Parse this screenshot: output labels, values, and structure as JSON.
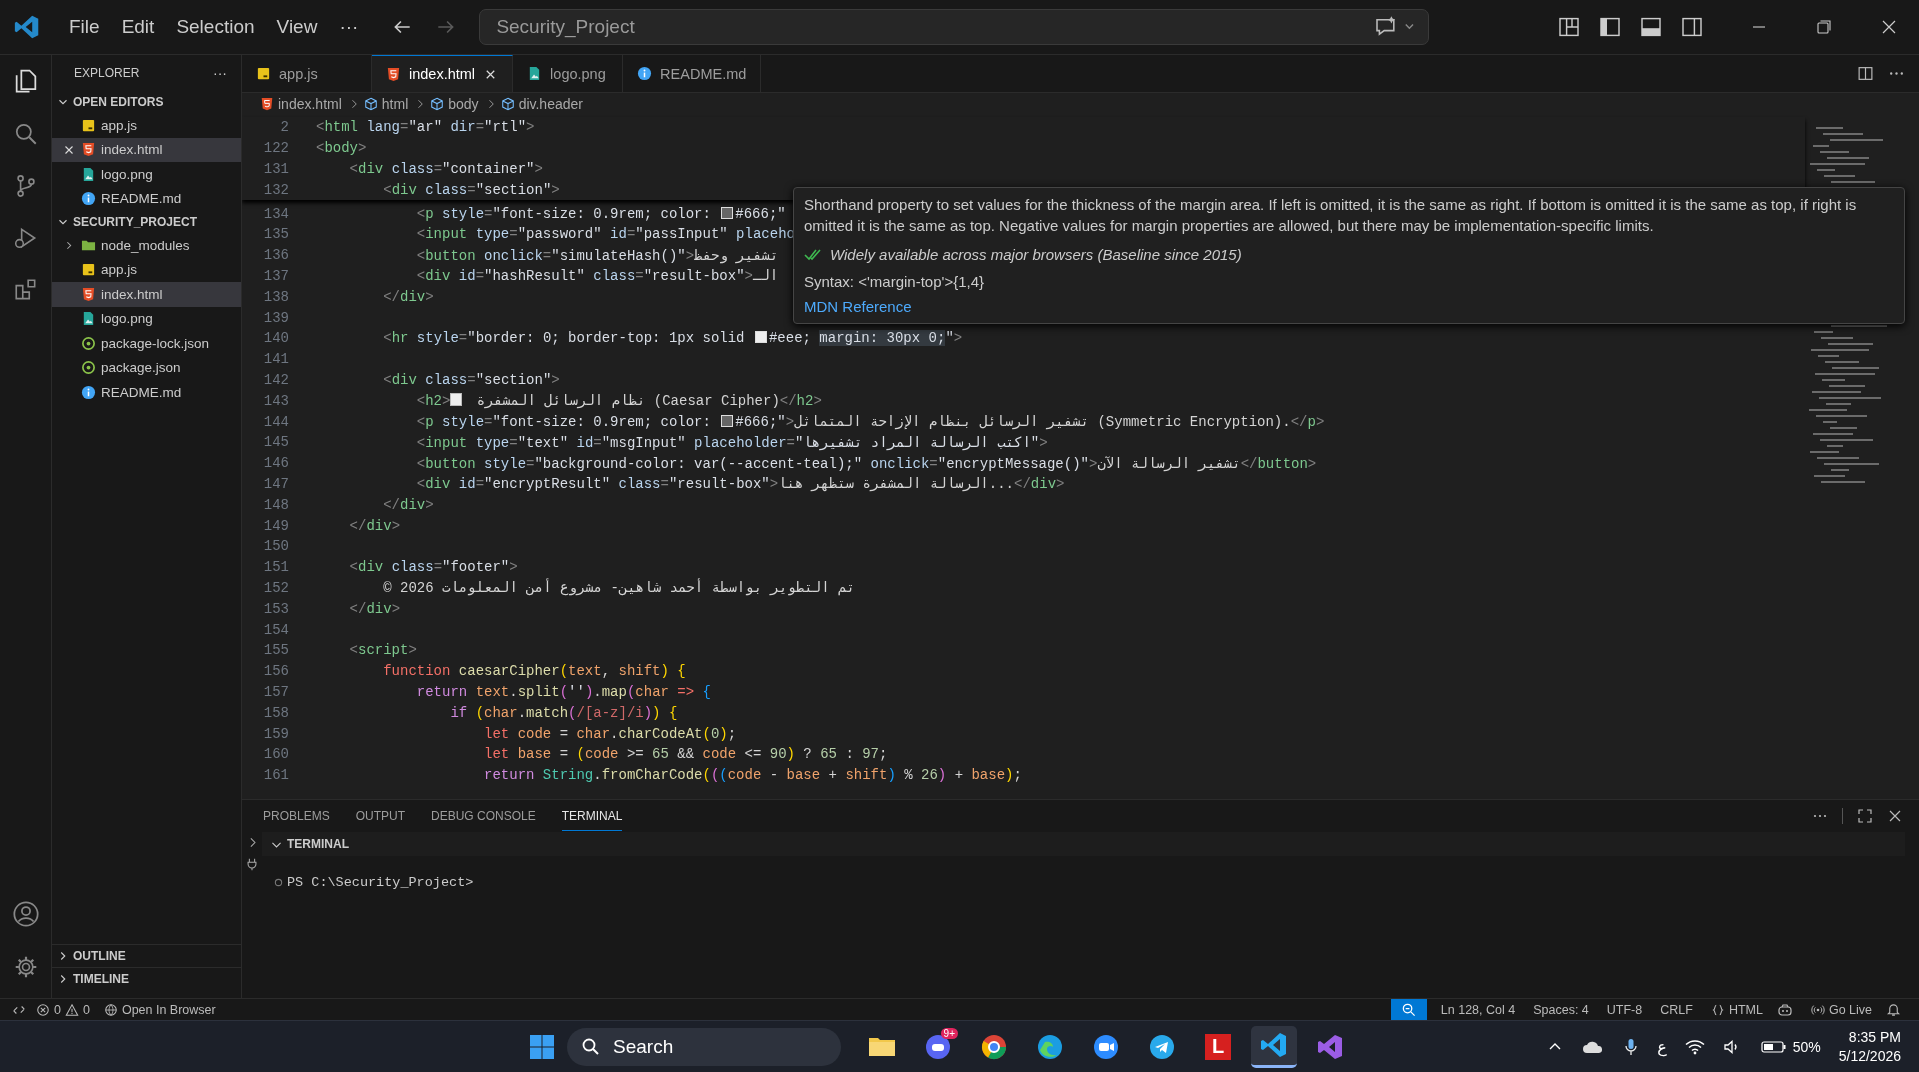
{
  "title_bar": {
    "menus": [
      "File",
      "Edit",
      "Selection",
      "View"
    ],
    "more": "···",
    "command_center": "Security_Project",
    "forward_disabled": true
  },
  "sidebar": {
    "title": "EXPLORER",
    "more": "···",
    "sections": [
      {
        "label": "OPEN EDITORS",
        "expanded": true,
        "items": [
          {
            "name": "app.js",
            "kind": "js",
            "selected": false
          },
          {
            "name": "index.html",
            "kind": "html",
            "selected": true
          },
          {
            "name": "logo.png",
            "kind": "png",
            "selected": false
          },
          {
            "name": "README.md",
            "kind": "md",
            "selected": false
          }
        ]
      },
      {
        "label": "SECURITY_PROJECT",
        "expanded": true,
        "items": [
          {
            "name": "node_modules",
            "kind": "folder",
            "selected": false,
            "expanded": false
          },
          {
            "name": "app.js",
            "kind": "js",
            "selected": false
          },
          {
            "name": "index.html",
            "kind": "html",
            "selected": true
          },
          {
            "name": "logo.png",
            "kind": "png",
            "selected": false
          },
          {
            "name": "package-lock.json",
            "kind": "json",
            "selected": false
          },
          {
            "name": "package.json",
            "kind": "json",
            "selected": false
          },
          {
            "name": "README.md",
            "kind": "md",
            "selected": false
          }
        ]
      }
    ],
    "bottom_sections": [
      {
        "label": "OUTLINE",
        "expanded": false
      },
      {
        "label": "TIMELINE",
        "expanded": false
      }
    ]
  },
  "tabs": [
    {
      "label": "app.js",
      "kind": "js",
      "selected": false
    },
    {
      "label": "index.html",
      "kind": "html",
      "selected": true
    },
    {
      "label": "logo.png",
      "kind": "png",
      "selected": false
    },
    {
      "label": "README.md",
      "kind": "md",
      "selected": false
    }
  ],
  "breadcrumb": [
    {
      "label": "index.html",
      "kind": "html"
    },
    {
      "label": "html",
      "kind": "symbol"
    },
    {
      "label": "body",
      "kind": "symbol"
    },
    {
      "label": "div.header",
      "kind": "symbol"
    }
  ],
  "editor": {
    "sticky_lines": [
      {
        "number": "2",
        "tokens": [
          {
            "kind": "pu",
            "text": "<"
          },
          {
            "kind": "tg",
            "text": "html"
          },
          {
            "kind": "at",
            "text": " lang"
          },
          {
            "kind": "pu",
            "text": "="
          },
          {
            "kind": "st",
            "text": "\"ar\""
          },
          {
            "kind": "at",
            "text": " dir"
          },
          {
            "kind": "pu",
            "text": "="
          },
          {
            "kind": "st",
            "text": "\"rtl\""
          },
          {
            "kind": "pu",
            "text": ">"
          }
        ]
      },
      {
        "number": "122",
        "tokens": [
          {
            "kind": "pu",
            "text": "<"
          },
          {
            "kind": "tg",
            "text": "body"
          },
          {
            "kind": "pu",
            "text": ">"
          }
        ]
      },
      {
        "number": "131",
        "tokens": [
          {
            "kind": "pu",
            "text": "    <"
          },
          {
            "kind": "tg",
            "text": "div"
          },
          {
            "kind": "at",
            "text": " class"
          },
          {
            "kind": "pu",
            "text": "="
          },
          {
            "kind": "st",
            "text": "\"container\""
          },
          {
            "kind": "pu",
            "text": ">"
          }
        ]
      },
      {
        "number": "132",
        "tokens": [
          {
            "kind": "pu",
            "text": "        <"
          },
          {
            "kind": "tg",
            "text": "div"
          },
          {
            "kind": "at",
            "text": " class"
          },
          {
            "kind": "pu",
            "text": "="
          },
          {
            "kind": "st",
            "text": "\"section\""
          },
          {
            "kind": "pu",
            "text": ">"
          }
        ]
      }
    ],
    "lines": [
      {
        "number": "134",
        "tokens": [
          {
            "kind": "pu",
            "text": "            <"
          },
          {
            "kind": "tg",
            "text": "p"
          },
          {
            "kind": "at",
            "text": " style"
          },
          {
            "kind": "pu",
            "text": "="
          },
          {
            "kind": "st",
            "text": "\"font-size: 0.9rem; color: "
          },
          {
            "kind": "swatch",
            "color": "#666666"
          },
          {
            "kind": "st",
            "text": "#666;\""
          }
        ]
      },
      {
        "number": "135",
        "tokens": [
          {
            "kind": "pu",
            "text": "            <"
          },
          {
            "kind": "tg",
            "text": "input"
          },
          {
            "kind": "at",
            "text": " type"
          },
          {
            "kind": "pu",
            "text": "="
          },
          {
            "kind": "st",
            "text": "\"password\""
          },
          {
            "kind": "at",
            "text": " id"
          },
          {
            "kind": "pu",
            "text": "="
          },
          {
            "kind": "st",
            "text": "\"passInput\""
          },
          {
            "kind": "at",
            "text": " placeho"
          }
        ]
      },
      {
        "number": "136",
        "tokens": [
          {
            "kind": "pu",
            "text": "            <"
          },
          {
            "kind": "tg",
            "text": "button"
          },
          {
            "kind": "at",
            "text": " onclick"
          },
          {
            "kind": "pu",
            "text": "="
          },
          {
            "kind": "st",
            "text": "\"simulateHash()\""
          },
          {
            "kind": "pu",
            "text": ">"
          },
          {
            "kind": "tx",
            "text": "تشفير وحفظ"
          }
        ]
      },
      {
        "number": "137",
        "tokens": [
          {
            "kind": "pu",
            "text": "            <"
          },
          {
            "kind": "tg",
            "text": "div"
          },
          {
            "kind": "at",
            "text": " id"
          },
          {
            "kind": "pu",
            "text": "="
          },
          {
            "kind": "st",
            "text": "\"hashResult\""
          },
          {
            "kind": "at",
            "text": " class"
          },
          {
            "kind": "pu",
            "text": "="
          },
          {
            "kind": "st",
            "text": "\"result-box\""
          },
          {
            "kind": "pu",
            "text": ">"
          },
          {
            "kind": "tx",
            "text": "الـ"
          }
        ]
      },
      {
        "number": "138",
        "tokens": [
          {
            "kind": "pu",
            "text": "        </"
          },
          {
            "kind": "tg",
            "text": "div"
          },
          {
            "kind": "pu",
            "text": ">"
          }
        ]
      },
      {
        "number": "139"
      },
      {
        "number": "140",
        "tokens": [
          {
            "kind": "pu",
            "text": "        <"
          },
          {
            "kind": "tg",
            "text": "hr"
          },
          {
            "kind": "at",
            "text": " style"
          },
          {
            "kind": "pu",
            "text": "="
          },
          {
            "kind": "st",
            "text": "\"border: 0; border-top: 1px solid "
          },
          {
            "kind": "swatch",
            "color": "#eeeeee"
          },
          {
            "kind": "st",
            "text": "#eee; "
          },
          {
            "kind": "hl",
            "text": "margin: 30px 0;"
          },
          {
            "kind": "st",
            "text": "\""
          },
          {
            "kind": "pu",
            "text": ">"
          }
        ]
      },
      {
        "number": "141"
      },
      {
        "number": "142",
        "tokens": [
          {
            "kind": "pu",
            "text": "        <"
          },
          {
            "kind": "tg",
            "text": "div"
          },
          {
            "kind": "at",
            "text": " class"
          },
          {
            "kind": "pu",
            "text": "="
          },
          {
            "kind": "st",
            "text": "\"section\""
          },
          {
            "kind": "pu",
            "text": ">"
          }
        ]
      },
      {
        "number": "143",
        "tokens": [
          {
            "kind": "pu",
            "text": "            <"
          },
          {
            "kind": "tg",
            "text": "h2"
          },
          {
            "kind": "pu",
            "text": ">"
          },
          {
            "kind": "tofu"
          },
          {
            "kind": "tx",
            "text": " نظام الرسائل المشفرة (Caesar Cipher)"
          },
          {
            "kind": "pu",
            "text": "</"
          },
          {
            "kind": "tg",
            "text": "h2"
          },
          {
            "kind": "pu",
            "text": ">"
          }
        ]
      },
      {
        "number": "144",
        "tokens": [
          {
            "kind": "pu",
            "text": "            <"
          },
          {
            "kind": "tg",
            "text": "p"
          },
          {
            "kind": "at",
            "text": " style"
          },
          {
            "kind": "pu",
            "text": "="
          },
          {
            "kind": "st",
            "text": "\"font-size: 0.9rem; color: "
          },
          {
            "kind": "swatch",
            "color": "#666666"
          },
          {
            "kind": "st",
            "text": "#666;\""
          },
          {
            "kind": "pu",
            "text": ">"
          },
          {
            "kind": "tx",
            "text": "تشفير الرسائل بنظام الإزاحة المتماثل (Symmetric Encryption)."
          },
          {
            "kind": "pu",
            "text": "</"
          },
          {
            "kind": "tg",
            "text": "p"
          },
          {
            "kind": "pu",
            "text": ">"
          }
        ]
      },
      {
        "number": "145",
        "tokens": [
          {
            "kind": "pu",
            "text": "            <"
          },
          {
            "kind": "tg",
            "text": "input"
          },
          {
            "kind": "at",
            "text": " type"
          },
          {
            "kind": "pu",
            "text": "="
          },
          {
            "kind": "st",
            "text": "\"text\""
          },
          {
            "kind": "at",
            "text": " id"
          },
          {
            "kind": "pu",
            "text": "="
          },
          {
            "kind": "st",
            "text": "\"msgInput\""
          },
          {
            "kind": "at",
            "text": " placeholder"
          },
          {
            "kind": "pu",
            "text": "="
          },
          {
            "kind": "st",
            "text": "\"اكتب الرسالة المراد تشفيرها\""
          },
          {
            "kind": "pu",
            "text": ">"
          }
        ]
      },
      {
        "number": "146",
        "tokens": [
          {
            "kind": "pu",
            "text": "            <"
          },
          {
            "kind": "tg",
            "text": "button"
          },
          {
            "kind": "at",
            "text": " style"
          },
          {
            "kind": "pu",
            "text": "="
          },
          {
            "kind": "st",
            "text": "\"background-color: var(--accent-teal);\""
          },
          {
            "kind": "at",
            "text": " onclick"
          },
          {
            "kind": "pu",
            "text": "="
          },
          {
            "kind": "st",
            "text": "\"encryptMessage()\""
          },
          {
            "kind": "pu",
            "text": ">"
          },
          {
            "kind": "tx",
            "text": "تشفير الرسالة الآن"
          },
          {
            "kind": "pu",
            "text": "</"
          },
          {
            "kind": "tg",
            "text": "button"
          },
          {
            "kind": "pu",
            "text": ">"
          }
        ]
      },
      {
        "number": "147",
        "tokens": [
          {
            "kind": "pu",
            "text": "            <"
          },
          {
            "kind": "tg",
            "text": "div"
          },
          {
            "kind": "at",
            "text": " id"
          },
          {
            "kind": "pu",
            "text": "="
          },
          {
            "kind": "st",
            "text": "\"encryptResult\""
          },
          {
            "kind": "at",
            "text": " class"
          },
          {
            "kind": "pu",
            "text": "="
          },
          {
            "kind": "st",
            "text": "\"result-box\""
          },
          {
            "kind": "pu",
            "text": ">"
          },
          {
            "kind": "tx",
            "text": "الرسالة المشفرة ستظهر هنا..."
          },
          {
            "kind": "pu",
            "text": "</"
          },
          {
            "kind": "tg",
            "text": "div"
          },
          {
            "kind": "pu",
            "text": ">"
          }
        ]
      },
      {
        "number": "148",
        "tokens": [
          {
            "kind": "pu",
            "text": "        </"
          },
          {
            "kind": "tg",
            "text": "div"
          },
          {
            "kind": "pu",
            "text": ">"
          }
        ]
      },
      {
        "number": "149",
        "tokens": [
          {
            "kind": "pu",
            "text": "    </"
          },
          {
            "kind": "tg",
            "text": "div"
          },
          {
            "kind": "pu",
            "text": ">"
          }
        ]
      },
      {
        "number": "150"
      },
      {
        "number": "151",
        "tokens": [
          {
            "kind": "pu",
            "text": "    <"
          },
          {
            "kind": "tg",
            "text": "div"
          },
          {
            "kind": "at",
            "text": " class"
          },
          {
            "kind": "pu",
            "text": "="
          },
          {
            "kind": "st",
            "text": "\"footer\""
          },
          {
            "kind": "pu",
            "text": ">"
          }
        ]
      },
      {
        "number": "152",
        "tokens": [
          {
            "kind": "tx",
            "text": "        © 2026 تم التطوير بواسطة أحمد شاهين- مشروع أمن المعلومات"
          }
        ]
      },
      {
        "number": "153",
        "tokens": [
          {
            "kind": "pu",
            "text": "    </"
          },
          {
            "kind": "tg",
            "text": "div"
          },
          {
            "kind": "pu",
            "text": ">"
          }
        ]
      },
      {
        "number": "154"
      },
      {
        "number": "155",
        "tokens": [
          {
            "kind": "pu",
            "text": "    <"
          },
          {
            "kind": "tg",
            "text": "script"
          },
          {
            "kind": "pu",
            "text": ">"
          }
        ]
      },
      {
        "number": "156",
        "tokens": [
          {
            "kind": "kw",
            "text": "        function "
          },
          {
            "kind": "fn",
            "text": "caesarCipher"
          },
          {
            "kind": "b1",
            "text": "("
          },
          {
            "kind": "pm",
            "text": "text"
          },
          {
            "kind": "tx",
            "text": ", "
          },
          {
            "kind": "pm",
            "text": "shift"
          },
          {
            "kind": "b1",
            "text": ")"
          },
          {
            "kind": "b1",
            "text": " {"
          }
        ]
      },
      {
        "number": "157",
        "tokens": [
          {
            "kind": "ct",
            "text": "            return "
          },
          {
            "kind": "pm",
            "text": "text"
          },
          {
            "kind": "tx",
            "text": "."
          },
          {
            "kind": "fn",
            "text": "split"
          },
          {
            "kind": "b2",
            "text": "("
          },
          {
            "kind": "st",
            "text": "''"
          },
          {
            "kind": "b2",
            "text": ")"
          },
          {
            "kind": "tx",
            "text": "."
          },
          {
            "kind": "fn",
            "text": "map"
          },
          {
            "kind": "b2",
            "text": "("
          },
          {
            "kind": "pm",
            "text": "char"
          },
          {
            "kind": "kw",
            "text": " => "
          },
          {
            "kind": "b3",
            "text": "{"
          }
        ]
      },
      {
        "number": "158",
        "tokens": [
          {
            "kind": "ct",
            "text": "                if "
          },
          {
            "kind": "b1",
            "text": "("
          },
          {
            "kind": "pm",
            "text": "char"
          },
          {
            "kind": "tx",
            "text": "."
          },
          {
            "kind": "fn",
            "text": "match"
          },
          {
            "kind": "b2",
            "text": "("
          },
          {
            "kind": "rx",
            "text": "/[a-z]/i"
          },
          {
            "kind": "b2",
            "text": ")"
          },
          {
            "kind": "b1",
            "text": ")"
          },
          {
            "kind": "b1",
            "text": " {"
          }
        ]
      },
      {
        "number": "159",
        "tokens": [
          {
            "kind": "kw",
            "text": "                    let "
          },
          {
            "kind": "pm",
            "text": "code"
          },
          {
            "kind": "tx",
            "text": " = "
          },
          {
            "kind": "pm",
            "text": "char"
          },
          {
            "kind": "tx",
            "text": "."
          },
          {
            "kind": "fn",
            "text": "charCodeAt"
          },
          {
            "kind": "b1",
            "text": "("
          },
          {
            "kind": "nu",
            "text": "0"
          },
          {
            "kind": "b1",
            "text": ")"
          },
          {
            "kind": "tx",
            "text": ";"
          }
        ]
      },
      {
        "number": "160",
        "tokens": [
          {
            "kind": "kw",
            "text": "                    let "
          },
          {
            "kind": "pm",
            "text": "base"
          },
          {
            "kind": "tx",
            "text": " = "
          },
          {
            "kind": "b1",
            "text": "("
          },
          {
            "kind": "pm",
            "text": "code"
          },
          {
            "kind": "tx",
            "text": " >= "
          },
          {
            "kind": "nu",
            "text": "65"
          },
          {
            "kind": "tx",
            "text": " && "
          },
          {
            "kind": "pm",
            "text": "code"
          },
          {
            "kind": "tx",
            "text": " <= "
          },
          {
            "kind": "nu",
            "text": "90"
          },
          {
            "kind": "b1",
            "text": ")"
          },
          {
            "kind": "tx",
            "text": " ? "
          },
          {
            "kind": "nu",
            "text": "65"
          },
          {
            "kind": "tx",
            "text": " : "
          },
          {
            "kind": "nu",
            "text": "97"
          },
          {
            "kind": "tx",
            "text": ";"
          }
        ]
      },
      {
        "number": "161",
        "tokens": [
          {
            "kind": "ct",
            "text": "                    return "
          },
          {
            "kind": "cl",
            "text": "String"
          },
          {
            "kind": "tx",
            "text": "."
          },
          {
            "kind": "fn",
            "text": "fromCharCode"
          },
          {
            "kind": "b1",
            "text": "("
          },
          {
            "kind": "b2",
            "text": "("
          },
          {
            "kind": "b3",
            "text": "("
          },
          {
            "kind": "pm",
            "text": "code"
          },
          {
            "kind": "tx",
            "text": " - "
          },
          {
            "kind": "pm",
            "text": "base"
          },
          {
            "kind": "tx",
            "text": " + "
          },
          {
            "kind": "pm",
            "text": "shift"
          },
          {
            "kind": "b3",
            "text": ")"
          },
          {
            "kind": "tx",
            "text": " % "
          },
          {
            "kind": "nu",
            "text": "26"
          },
          {
            "kind": "b2",
            "text": ")"
          },
          {
            "kind": "tx",
            "text": " + "
          },
          {
            "kind": "pm",
            "text": "base"
          },
          {
            "kind": "b1",
            "text": ")"
          },
          {
            "kind": "tx",
            "text": ";"
          }
        ]
      }
    ]
  },
  "hover": {
    "description": "Shorthand property to set values for the thickness of the margin area. If left is omitted, it is the same as right. If bottom is omitted it is the same as top, if right is omitted it is the same as top. Negative values for margin properties are allowed, but there may be implementation-specific limits.",
    "baseline": "Widely available across major browsers (Baseline since 2015)",
    "syntax": "Syntax: <'margin-top'>{1,4}",
    "link": "MDN Reference"
  },
  "panel": {
    "tabs": [
      {
        "label": "PROBLEMS",
        "selected": false
      },
      {
        "label": "OUTPUT",
        "selected": false
      },
      {
        "label": "DEBUG CONSOLE",
        "selected": false
      },
      {
        "label": "TERMINAL",
        "selected": true
      }
    ],
    "terminal": {
      "title": "TERMINAL",
      "prompt": "PS C:\\Security_Project>"
    }
  },
  "status_bar": {
    "errors": "0",
    "warnings": "0",
    "open_in_browser": "Open In Browser",
    "position": "Ln 128, Col 4",
    "spaces": "Spaces: 4",
    "encoding": "UTF-8",
    "eol": "CRLF",
    "language": "HTML",
    "go_live": "Go Live"
  },
  "taskbar": {
    "search": "Search",
    "apps": [
      {
        "kind": "folder",
        "active": false
      },
      {
        "kind": "chat",
        "active": false,
        "badge": "9+"
      },
      {
        "kind": "browser",
        "active": false
      },
      {
        "kind": "edge",
        "active": false
      },
      {
        "kind": "zoom",
        "active": false
      },
      {
        "kind": "telegram",
        "active": false
      },
      {
        "kind": "letter",
        "active": false,
        "label": "L"
      },
      {
        "kind": "vscode",
        "active": true
      },
      {
        "kind": "studio",
        "active": false
      }
    ],
    "language": "ع",
    "battery": "50%",
    "time": "8:35 PM",
    "date": "5/12/2026"
  }
}
